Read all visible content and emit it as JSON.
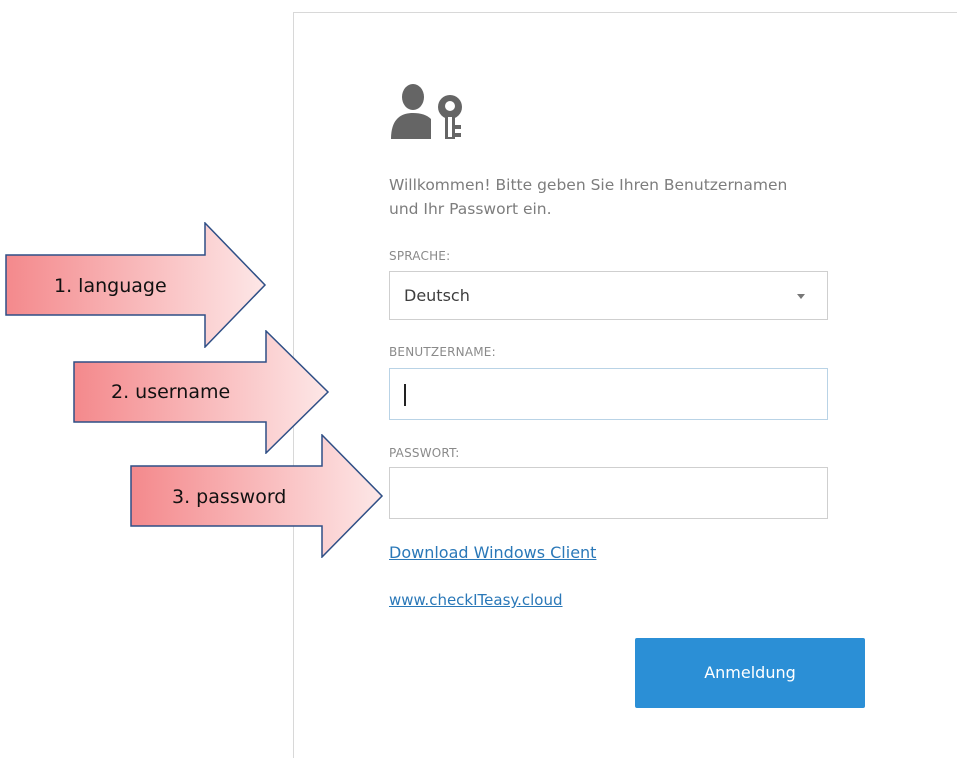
{
  "login": {
    "welcome_text": "Willkommen! Bitte geben Sie Ihren Benutzernamen und Ihr Passwort ein.",
    "language_label": "SPRACHE:",
    "language_value": "Deutsch",
    "username_label": "BENUTZERNAME:",
    "username_value": "",
    "password_label": "PASSWORT:",
    "password_value": "",
    "download_link": "Download Windows Client",
    "website_link": "www.checkITeasy.cloud",
    "login_button": "Anmeldung"
  },
  "annotations": [
    {
      "label": "1. language"
    },
    {
      "label": "2. username"
    },
    {
      "label": "3. password"
    }
  ],
  "colors": {
    "accent": "#2b8fd6",
    "link": "#2a78b8",
    "arrow_fill_light": "#fde3e3",
    "arrow_fill_dark": "#f4898c",
    "arrow_stroke": "#2f4f86"
  },
  "icons": {
    "header": "user-key-icon",
    "select": "chevron-down-icon"
  }
}
